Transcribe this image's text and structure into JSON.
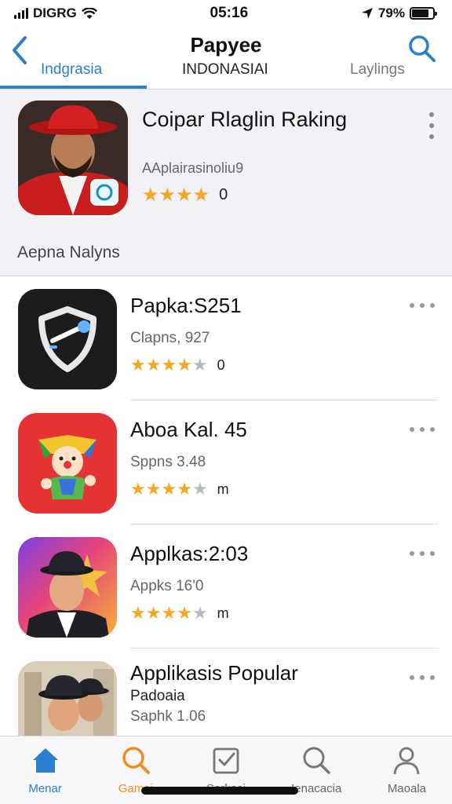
{
  "status": {
    "carrier": "DIGRG",
    "time": "05:16",
    "battery": "79%",
    "battery_level": 0.79
  },
  "header": {
    "title": "Papyee",
    "tabs": [
      {
        "label": "Indgrasia",
        "active": true
      },
      {
        "label": "INDONASIAI",
        "active": false
      },
      {
        "label": "Laylings",
        "active": false
      }
    ]
  },
  "featured": {
    "title": "Coipar Rlaglin Raking",
    "subtitle": "AAplairasinoliu9",
    "rating_stars": 4,
    "rating_text": "0"
  },
  "section_title": "Aepna Nalyns",
  "apps": [
    {
      "name": "Papka:S251",
      "subtitle": "Clapns, 927",
      "rating_stars": 4,
      "rating_text": "0",
      "icon": "shield-icon"
    },
    {
      "name": "Aboa Kal. 45",
      "subtitle": "Sppns 3.48",
      "rating_stars": 4,
      "rating_text": "m",
      "icon": "clown-icon"
    },
    {
      "name": "Applkas:2:03",
      "subtitle": "Appks 16'0",
      "rating_stars": 4,
      "rating_text": "m",
      "icon": "man-hat-icon"
    },
    {
      "name": "Applikasis Popular",
      "subtitle": "Padoaia",
      "subtitle2": "Saphk 1.06",
      "icon": "two-men-icon"
    }
  ],
  "tabbar": [
    {
      "label": "Menar",
      "icon": "home-icon",
      "active": true
    },
    {
      "label": "Gamei",
      "icon": "search-icon",
      "active": false
    },
    {
      "label": "Sarkasi",
      "icon": "checklist-icon",
      "active": false
    },
    {
      "label": "Ienacacia",
      "icon": "search-icon",
      "active": false
    },
    {
      "label": "Maoala",
      "icon": "person-icon",
      "active": false
    }
  ],
  "colors": {
    "accent": "#2a7fd1",
    "star": "#f5a623",
    "star_empty": "#b9b9b9",
    "gamei": "#f08c1e"
  }
}
